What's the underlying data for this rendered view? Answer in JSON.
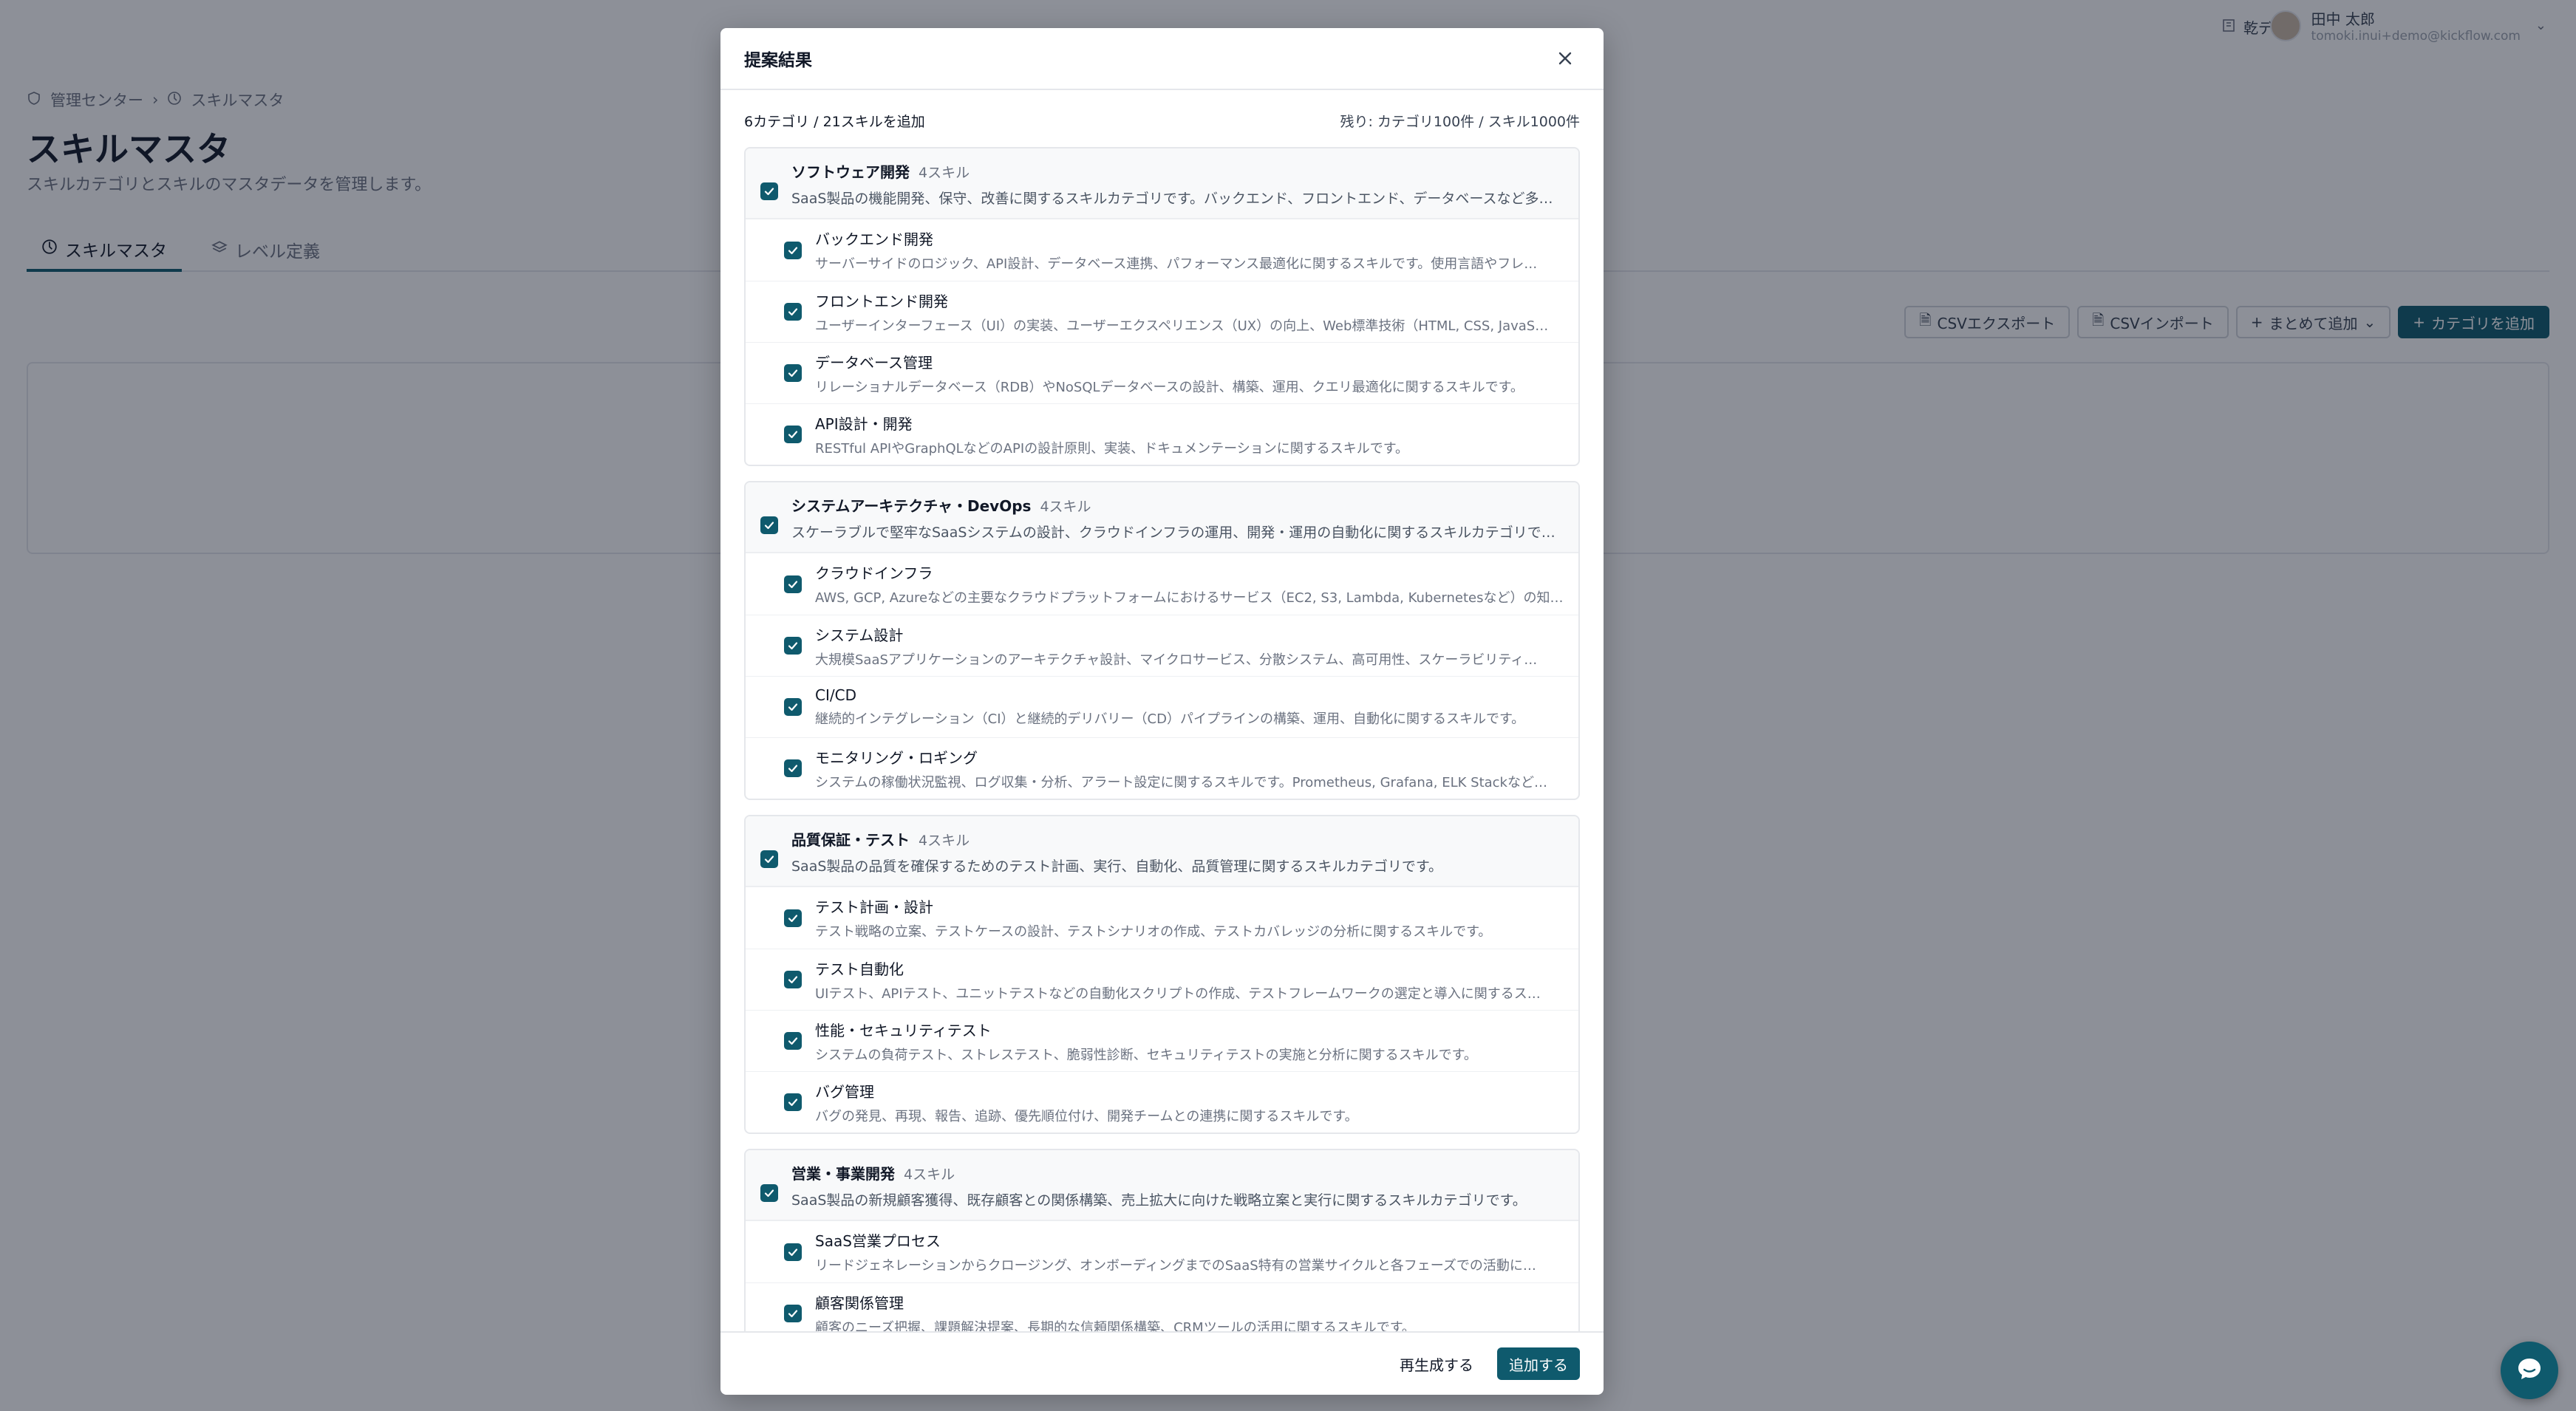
{
  "topbar": {
    "tenant": "乾デモ",
    "user_name": "田中 太郎",
    "user_email": "tomoki.inui+demo@kickflow.com"
  },
  "breadcrumb": {
    "item1": "管理センター",
    "item2": "スキルマスタ"
  },
  "page": {
    "title": "スキルマスタ",
    "subtitle": "スキルカテゴリとスキルのマスタデータを管理します。"
  },
  "tabs": {
    "tab1": "スキルマスタ",
    "tab2": "レベル定義"
  },
  "toolbar": {
    "export": "CSVエクスポート",
    "import": "CSVインポート",
    "bulk_add": "まとめて追加",
    "add_category": "カテゴリを追加"
  },
  "modal": {
    "title": "提案結果",
    "summary": "6カテゴリ / 21スキルを追加",
    "remaining": "残り: カテゴリ100件 / スキル1000件",
    "regenerate": "再生成する",
    "add": "追加する",
    "categories": [
      {
        "name": "ソフトウェア開発",
        "count": "4スキル",
        "desc": "SaaS製品の機能開発、保守、改善に関するスキルカテゴリです。バックエンド、フロントエンド、データベースなど多岐に…",
        "skills": [
          {
            "name": "バックエンド開発",
            "desc": "サーバーサイドのロジック、API設計、データベース連携、パフォーマンス最適化に関するスキルです。使用言語やフレ…"
          },
          {
            "name": "フロントエンド開発",
            "desc": "ユーザーインターフェース（UI）の実装、ユーザーエクスペリエンス（UX）の向上、Web標準技術（HTML, CSS, JavaS…"
          },
          {
            "name": "データベース管理",
            "desc": "リレーショナルデータベース（RDB）やNoSQLデータベースの設計、構築、運用、クエリ最適化に関するスキルです。"
          },
          {
            "name": "API設計・開発",
            "desc": "RESTful APIやGraphQLなどのAPIの設計原則、実装、ドキュメンテーションに関するスキルです。"
          }
        ]
      },
      {
        "name": "システムアーキテクチャ・DevOps",
        "count": "4スキル",
        "desc": "スケーラブルで堅牢なSaaSシステムの設計、クラウドインフラの運用、開発・運用の自動化に関するスキルカテゴリです。",
        "skills": [
          {
            "name": "クラウドインフラ",
            "desc": "AWS, GCP, Azureなどの主要なクラウドプラットフォームにおけるサービス（EC2, S3, Lambda, Kubernetesなど）の知…"
          },
          {
            "name": "システム設計",
            "desc": "大規模SaaSアプリケーションのアーキテクチャ設計、マイクロサービス、分散システム、高可用性、スケーラビリティ…"
          },
          {
            "name": "CI/CD",
            "desc": "継続的インテグレーション（CI）と継続的デリバリー（CD）パイプラインの構築、運用、自動化に関するスキルです。"
          },
          {
            "name": "モニタリング・ロギング",
            "desc": "システムの稼働状況監視、ログ収集・分析、アラート設定に関するスキルです。Prometheus, Grafana, ELK Stackなど…"
          }
        ]
      },
      {
        "name": "品質保証・テスト",
        "count": "4スキル",
        "desc": "SaaS製品の品質を確保するためのテスト計画、実行、自動化、品質管理に関するスキルカテゴリです。",
        "skills": [
          {
            "name": "テスト計画・設計",
            "desc": "テスト戦略の立案、テストケースの設計、テストシナリオの作成、テストカバレッジの分析に関するスキルです。"
          },
          {
            "name": "テスト自動化",
            "desc": "UIテスト、APIテスト、ユニットテストなどの自動化スクリプトの作成、テストフレームワークの選定と導入に関するス…"
          },
          {
            "name": "性能・セキュリティテスト",
            "desc": "システムの負荷テスト、ストレステスト、脆弱性診断、セキュリティテストの実施と分析に関するスキルです。"
          },
          {
            "name": "バグ管理",
            "desc": "バグの発見、再現、報告、追跡、優先順位付け、開発チームとの連携に関するスキルです。"
          }
        ]
      },
      {
        "name": "営業・事業開発",
        "count": "4スキル",
        "desc": "SaaS製品の新規顧客獲得、既存顧客との関係構築、売上拡大に向けた戦略立案と実行に関するスキルカテゴリです。",
        "skills": [
          {
            "name": "SaaS営業プロセス",
            "desc": "リードジェネレーションからクロージング、オンボーディングまでのSaaS特有の営業サイクルと各フェーズでの活動に…"
          },
          {
            "name": "顧客関係管理",
            "desc": "顧客のニーズ把握、課題解決提案、長期的な信頼関係構築、CRMツールの活用に関するスキルです。"
          }
        ]
      }
    ]
  }
}
